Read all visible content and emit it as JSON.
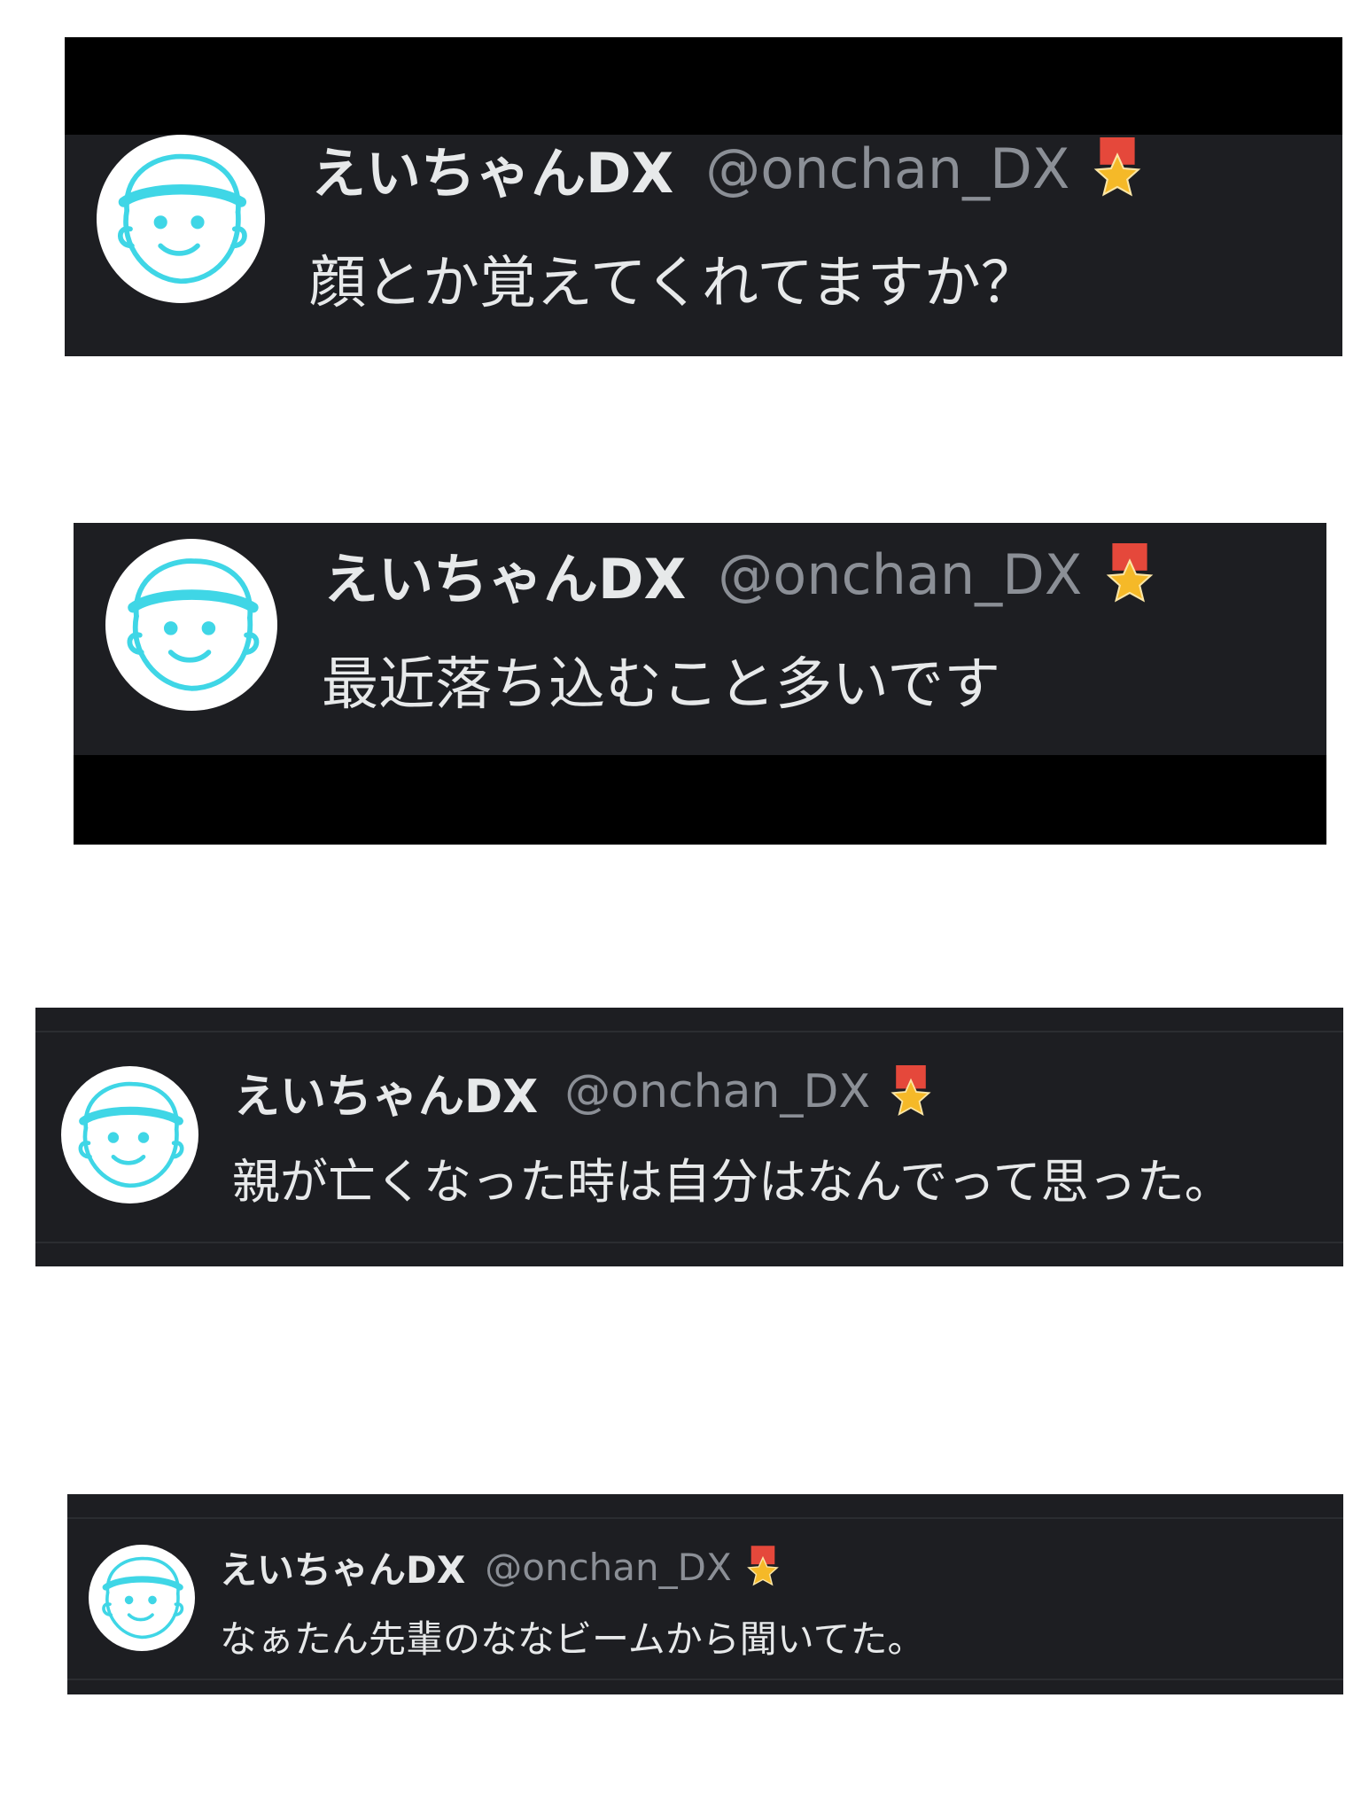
{
  "colors": {
    "background": "#ffffff",
    "panel": "#1d1e22",
    "redaction_bar": "#000000",
    "name": "#e7e9ea",
    "handle": "#8b8f96",
    "avatar_outline": "#3fd6e6",
    "badge_ribbon": "#e5483b",
    "badge_star": "#f5b928"
  },
  "icons": {
    "avatar": "cartoon-face-avatar-icon",
    "badge": "star-ribbon-badge-icon"
  },
  "posts": [
    {
      "display_name": "えいちゃんDX",
      "handle": "@onchan_DX",
      "text": "顔とか覚えてくれてますか？"
    },
    {
      "display_name": "えいちゃんDX",
      "handle": "@onchan_DX",
      "text": "最近落ち込むこと多いです"
    },
    {
      "display_name": "えいちゃんDX",
      "handle": "@onchan_DX",
      "text": "親が亡くなった時は自分はなんでって思った。"
    },
    {
      "display_name": "えいちゃんDX",
      "handle": "@onchan_DX",
      "text": "なぁたん先輩のななビームから聞いてた。"
    }
  ]
}
